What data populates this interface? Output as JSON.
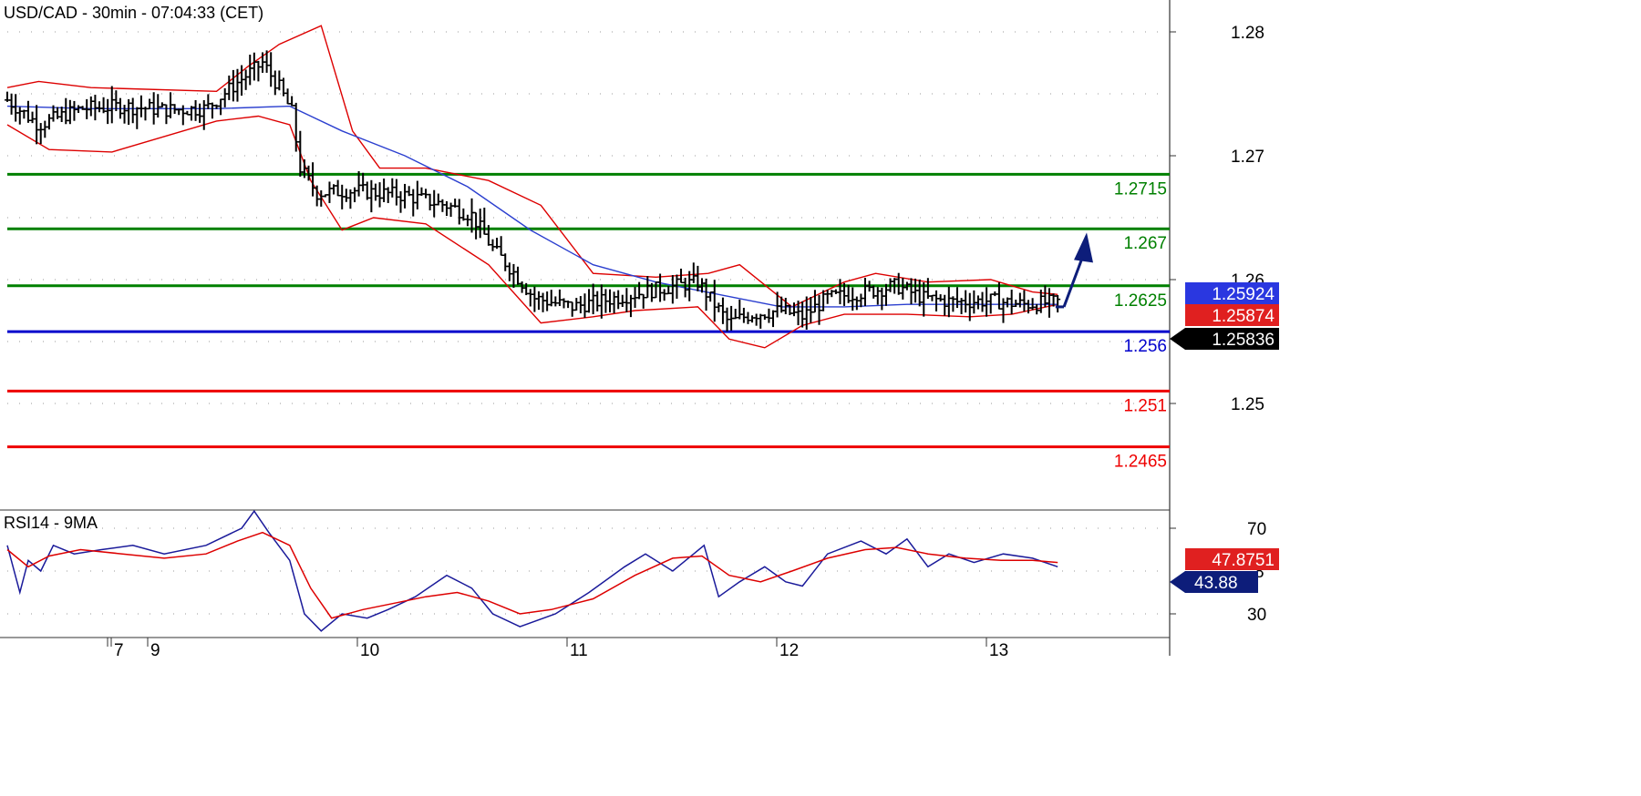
{
  "chart_data": [
    {
      "type": "candlestick",
      "title": "USD/CAD - 30min - 07:04:33 (CET)",
      "ylim": [
        1.2425,
        1.2815
      ],
      "y_ticks": [
        "1.28",
        "1.27",
        "1.26",
        "1.25"
      ],
      "x_ticks": [
        "7",
        "9",
        "10",
        "11",
        "12",
        "13"
      ],
      "grid": true,
      "price_path": [
        [
          0,
          1.2745
        ],
        [
          15,
          1.2725
        ],
        [
          35,
          1.2738
        ],
        [
          55,
          1.274
        ],
        [
          75,
          1.2737
        ],
        [
          95,
          1.2738
        ],
        [
          112,
          1.2762
        ],
        [
          122,
          1.2775
        ],
        [
          130,
          1.2755
        ],
        [
          136,
          1.2735
        ],
        [
          140,
          1.269
        ],
        [
          148,
          1.267
        ],
        [
          165,
          1.2672
        ],
        [
          190,
          1.2668
        ],
        [
          210,
          1.266
        ],
        [
          222,
          1.2652
        ],
        [
          232,
          1.2625
        ],
        [
          240,
          1.261
        ],
        [
          252,
          1.2585
        ],
        [
          270,
          1.2578
        ],
        [
          290,
          1.2585
        ],
        [
          310,
          1.2592
        ],
        [
          330,
          1.2598
        ],
        [
          338,
          1.258
        ],
        [
          345,
          1.2565
        ],
        [
          355,
          1.2572
        ],
        [
          370,
          1.2575
        ],
        [
          380,
          1.257
        ],
        [
          392,
          1.2585
        ],
        [
          410,
          1.259
        ],
        [
          425,
          1.2595
        ],
        [
          438,
          1.2585
        ],
        [
          452,
          1.2582
        ],
        [
          470,
          1.2583
        ],
        [
          485,
          1.258
        ],
        [
          502,
          1.2582
        ]
      ],
      "moving_average": [
        [
          0,
          1.274
        ],
        [
          40,
          1.2738
        ],
        [
          100,
          1.2738
        ],
        [
          135,
          1.274
        ],
        [
          160,
          1.272
        ],
        [
          190,
          1.27
        ],
        [
          220,
          1.2675
        ],
        [
          250,
          1.264
        ],
        [
          280,
          1.2612
        ],
        [
          310,
          1.2598
        ],
        [
          340,
          1.2588
        ],
        [
          370,
          1.2578
        ],
        [
          400,
          1.2578
        ],
        [
          430,
          1.258
        ],
        [
          460,
          1.258
        ],
        [
          502,
          1.258
        ]
      ],
      "bollinger_upper": [
        [
          0,
          1.2755
        ],
        [
          15,
          1.276
        ],
        [
          40,
          1.2755
        ],
        [
          100,
          1.2752
        ],
        [
          115,
          1.2772
        ],
        [
          130,
          1.279
        ],
        [
          150,
          1.2805
        ],
        [
          165,
          1.272
        ],
        [
          178,
          1.269
        ],
        [
          200,
          1.269
        ],
        [
          230,
          1.268
        ],
        [
          255,
          1.266
        ],
        [
          280,
          1.2605
        ],
        [
          310,
          1.2602
        ],
        [
          335,
          1.2605
        ],
        [
          350,
          1.2612
        ],
        [
          375,
          1.2578
        ],
        [
          400,
          1.2598
        ],
        [
          415,
          1.2605
        ],
        [
          440,
          1.2598
        ],
        [
          470,
          1.26
        ],
        [
          490,
          1.259
        ],
        [
          502,
          1.2588
        ]
      ],
      "bollinger_lower": [
        [
          0,
          1.2725
        ],
        [
          20,
          1.2705
        ],
        [
          50,
          1.2703
        ],
        [
          100,
          1.2728
        ],
        [
          120,
          1.2732
        ],
        [
          135,
          1.2725
        ],
        [
          145,
          1.268
        ],
        [
          160,
          1.264
        ],
        [
          175,
          1.265
        ],
        [
          200,
          1.2645
        ],
        [
          230,
          1.2612
        ],
        [
          255,
          1.2565
        ],
        [
          280,
          1.257
        ],
        [
          300,
          1.2575
        ],
        [
          330,
          1.2578
        ],
        [
          345,
          1.2552
        ],
        [
          362,
          1.2545
        ],
        [
          380,
          1.2563
        ],
        [
          400,
          1.2572
        ],
        [
          430,
          1.2572
        ],
        [
          460,
          1.257
        ],
        [
          480,
          1.2572
        ],
        [
          502,
          1.258
        ]
      ],
      "levels": [
        {
          "value": 1.2685,
          "label": "1.2715",
          "color": "#008000"
        },
        {
          "value": 1.2641,
          "label": "1.267",
          "color": "#008000"
        },
        {
          "value": 1.2595,
          "label": "1.2625",
          "color": "#008000"
        },
        {
          "value": 1.2558,
          "label": "1.256",
          "color": "#0000cc"
        },
        {
          "value": 1.251,
          "label": "1.251",
          "color": "#ee0000"
        },
        {
          "value": 1.2465,
          "label": "1.2465",
          "color": "#ee0000"
        }
      ],
      "arrow": {
        "from": [
          505,
          1.2578
        ],
        "to": [
          515,
          1.2635
        ],
        "color": "#0d1d7a"
      },
      "price_badges": [
        {
          "label": "1.25924",
          "value": 1.25924,
          "bg": "#2a37e0"
        },
        {
          "label": "1.25874",
          "value": 1.25874,
          "bg": "#e02020"
        },
        {
          "label": "1.25836",
          "value": 1.25836,
          "bg": "#000000"
        }
      ]
    },
    {
      "type": "line",
      "title": "RSI14 - 9MA",
      "ylim": [
        15,
        85
      ],
      "y_ticks": [
        "70",
        "30"
      ],
      "partial_label": "8",
      "series": [
        {
          "color": "#1a1a9a",
          "values": [
            [
              0,
              62
            ],
            [
              6,
              40
            ],
            [
              10,
              55
            ],
            [
              16,
              50
            ],
            [
              22,
              62
            ],
            [
              32,
              58
            ],
            [
              45,
              60
            ],
            [
              60,
              62
            ],
            [
              75,
              58
            ],
            [
              95,
              62
            ],
            [
              112,
              70
            ],
            [
              118,
              78
            ],
            [
              125,
              68
            ],
            [
              135,
              55
            ],
            [
              142,
              30
            ],
            [
              150,
              22
            ],
            [
              160,
              30
            ],
            [
              172,
              28
            ],
            [
              182,
              32
            ],
            [
              195,
              38
            ],
            [
              210,
              48
            ],
            [
              222,
              42
            ],
            [
              232,
              30
            ],
            [
              245,
              24
            ],
            [
              262,
              30
            ],
            [
              278,
              40
            ],
            [
              295,
              52
            ],
            [
              305,
              58
            ],
            [
              318,
              50
            ],
            [
              333,
              62
            ],
            [
              340,
              38
            ],
            [
              350,
              45
            ],
            [
              362,
              52
            ],
            [
              372,
              45
            ],
            [
              380,
              43
            ],
            [
              392,
              58
            ],
            [
              408,
              64
            ],
            [
              420,
              58
            ],
            [
              430,
              65
            ],
            [
              440,
              52
            ],
            [
              450,
              58
            ],
            [
              462,
              54
            ],
            [
              476,
              58
            ],
            [
              490,
              56
            ],
            [
              502,
              52
            ]
          ]
        },
        {
          "color": "#dd0000",
          "values": [
            [
              0,
              60
            ],
            [
              10,
              52
            ],
            [
              20,
              57
            ],
            [
              35,
              60
            ],
            [
              55,
              58
            ],
            [
              75,
              56
            ],
            [
              95,
              58
            ],
            [
              110,
              64
            ],
            [
              122,
              68
            ],
            [
              135,
              62
            ],
            [
              145,
              42
            ],
            [
              155,
              28
            ],
            [
              170,
              32
            ],
            [
              185,
              35
            ],
            [
              200,
              38
            ],
            [
              215,
              40
            ],
            [
              230,
              36
            ],
            [
              245,
              30
            ],
            [
              260,
              32
            ],
            [
              280,
              37
            ],
            [
              300,
              48
            ],
            [
              318,
              56
            ],
            [
              332,
              57
            ],
            [
              345,
              48
            ],
            [
              360,
              45
            ],
            [
              375,
              50
            ],
            [
              392,
              56
            ],
            [
              410,
              60
            ],
            [
              425,
              61
            ],
            [
              440,
              58
            ],
            [
              458,
              56
            ],
            [
              475,
              55
            ],
            [
              490,
              55
            ],
            [
              502,
              54
            ]
          ]
        }
      ],
      "value_badges": [
        {
          "label": "47.8751",
          "value": 53.5,
          "bg": "#e02020"
        },
        {
          "label": "43.88",
          "value": 47,
          "bg": "#0d1d7a"
        }
      ]
    }
  ]
}
